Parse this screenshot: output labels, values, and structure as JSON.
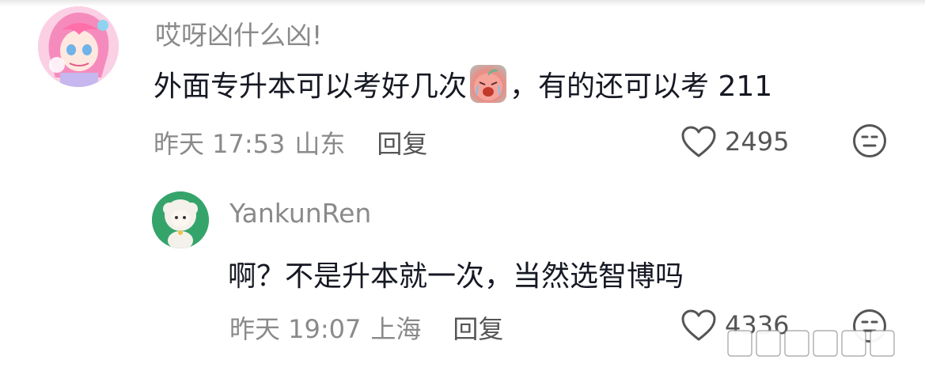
{
  "comments": [
    {
      "username": "哎呀凶什么凶!",
      "text_before": "外面专升本可以考好几次",
      "text_after": "，有的还可以考 211",
      "time": "昨天 17:53",
      "location": "山东",
      "reply_label": "回复",
      "likes": "2495"
    },
    {
      "username": "YankunRen",
      "text": "啊？不是升本就一次，当然选智博吗",
      "time": "昨天 19:07",
      "location": "上海",
      "reply_label": "回复",
      "likes": "4336"
    }
  ],
  "icons": {
    "like": "heart-icon",
    "react": "neutral-face-icon",
    "emoji": "crying-peach-emoji"
  }
}
